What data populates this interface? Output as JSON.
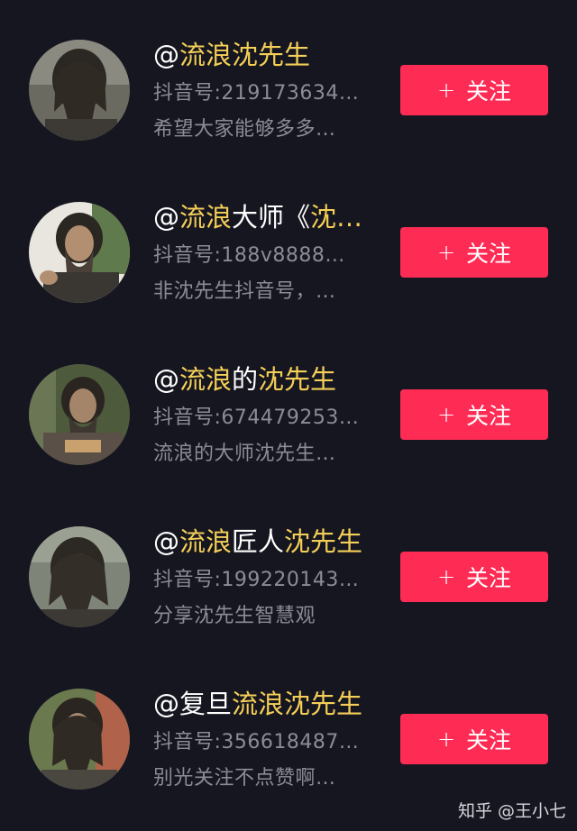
{
  "accent_color": "#fe2c55",
  "highlight_color": "#f4cf57",
  "follow_label": "关注",
  "follow_plus": "+",
  "users": [
    {
      "name_parts": [
        "@",
        "流浪沈先生",
        "",
        ""
      ],
      "id_line": "抖音号:219173634…",
      "bio_line": "希望大家能够多多…"
    },
    {
      "name_parts": [
        "@",
        "流浪",
        "大师《",
        "沈…"
      ],
      "id_line": "抖音号:188v8888…",
      "bio_line": "非沈先生抖音号，…"
    },
    {
      "name_parts": [
        "@",
        "流浪",
        "的",
        "沈先生"
      ],
      "id_line": "抖音号:674479253…",
      "bio_line": "流浪的大师沈先生…"
    },
    {
      "name_parts": [
        "@",
        "流浪",
        "匠人",
        "沈先生"
      ],
      "id_line": "抖音号:199220143…",
      "bio_line": "分享沈先生智慧观"
    },
    {
      "name_parts": [
        "@复旦",
        "流浪沈先生",
        "",
        ""
      ],
      "id_line": "抖音号:356618487…",
      "bio_line": "别光关注不点赞啊…"
    }
  ],
  "watermark": "知乎 @王小七"
}
